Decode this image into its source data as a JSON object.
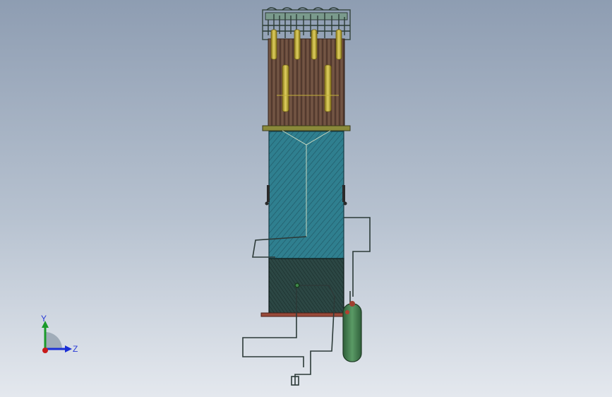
{
  "triad": {
    "y_label": "Y",
    "z_label": "Z",
    "x_color": "#c81a1a",
    "y_color": "#1a9a2a",
    "z_color": "#1a2fd6"
  },
  "model": {
    "shell_top_color": "#6b4b3c",
    "shell_mid_color": "#2f7f8f",
    "shell_bottom_color": "#26423f",
    "tank_color": "#3f7f4f",
    "tubes_color": "#c5b23a"
  }
}
